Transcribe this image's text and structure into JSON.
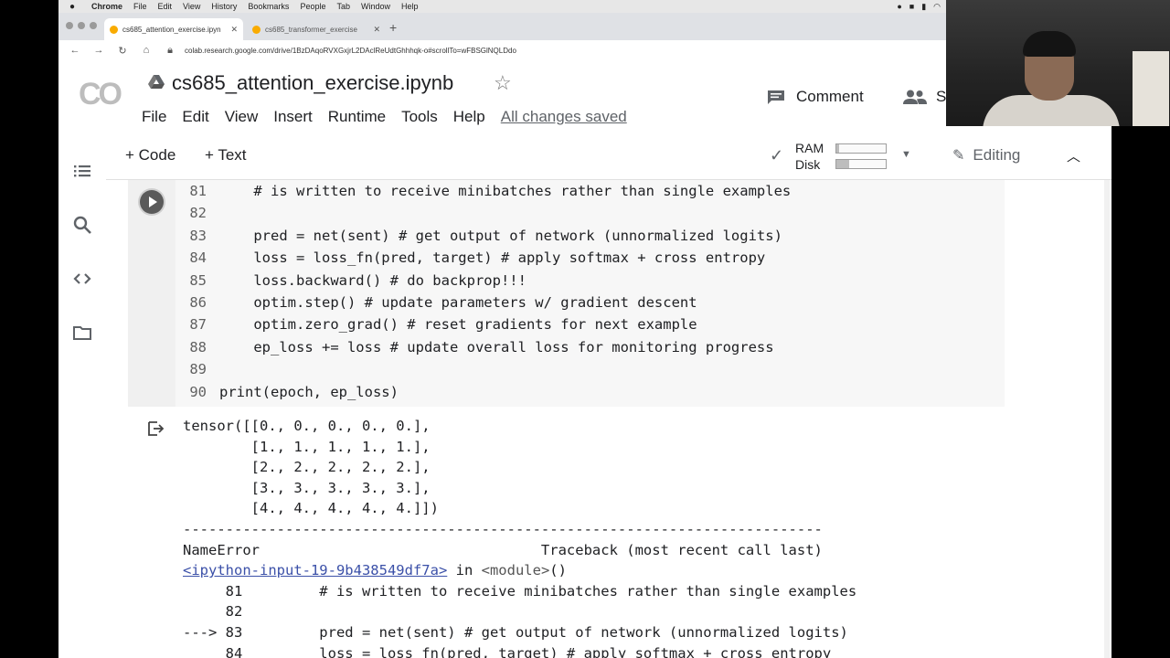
{
  "menubar": {
    "apple": "",
    "items": [
      "Chrome",
      "File",
      "Edit",
      "View",
      "History",
      "Bookmarks",
      "People",
      "Tab",
      "Window",
      "Help"
    ]
  },
  "tabs": [
    {
      "label": "cs685_attention_exercise.ipyn"
    },
    {
      "label": "cs685_transformer_exercise"
    }
  ],
  "address": {
    "url": "colab.research.google.com/drive/1BzDAqoRVXGxjrL2DAclReUdtGhhhqk-o#scrollTo=wFBSGlNQLDdo"
  },
  "header": {
    "logo": "CO",
    "title": "cs685_attention_exercise.ipynb",
    "menu": [
      "File",
      "Edit",
      "View",
      "Insert",
      "Runtime",
      "Tools",
      "Help"
    ],
    "saved_status": "All changes saved",
    "comment_label": "Comment",
    "share_label": "S"
  },
  "toolbar": {
    "add_code": "+ Code",
    "add_text": "+ Text",
    "ram_label": "RAM",
    "disk_label": "Disk",
    "ram_fraction": 0.05,
    "disk_fraction": 0.25,
    "editing_label": "Editing"
  },
  "code_lines": [
    {
      "n": "81",
      "text": "    # is written to receive minibatches rather than single examples"
    },
    {
      "n": "82",
      "text": ""
    },
    {
      "n": "83",
      "text": "    pred = net(sent) # get output of network (unnormalized logits)"
    },
    {
      "n": "84",
      "text": "    loss = loss_fn(pred, target) # apply softmax + cross entropy"
    },
    {
      "n": "85",
      "text": "    loss.backward() # do backprop!!!"
    },
    {
      "n": "86",
      "text": "    optim.step() # update parameters w/ gradient descent"
    },
    {
      "n": "87",
      "text": "    optim.zero_grad() # reset gradients for next example"
    },
    {
      "n": "88",
      "text": "    ep_loss += loss # update overall loss for monitoring progress"
    },
    {
      "n": "89",
      "text": ""
    },
    {
      "n": "90",
      "text": "print(epoch, ep_loss)"
    }
  ],
  "output": {
    "tensor_lines": [
      "tensor([[0., 0., 0., 0., 0.],",
      "        [1., 1., 1., 1., 1.],",
      "        [2., 2., 2., 2., 2.],",
      "        [3., 3., 3., 3., 3.],",
      "        [4., 4., 4., 4., 4.]])"
    ],
    "separator": "---------------------------------------------------------------------------",
    "error_header": "NameError                                 Traceback (most recent call last)",
    "trace_link": "<ipython-input-19-9b438549df7a>",
    "trace_in": " in ",
    "trace_module": "<module>",
    "trace_paren": "()",
    "trace_lines": [
      "     81         # is written to receive minibatches rather than single examples",
      "     82 ",
      "---> 83         pred = net(sent) # get output of network (unnormalized logits)",
      "     84         loss = loss_fn(pred, target) # apply softmax + cross entropy"
    ]
  }
}
